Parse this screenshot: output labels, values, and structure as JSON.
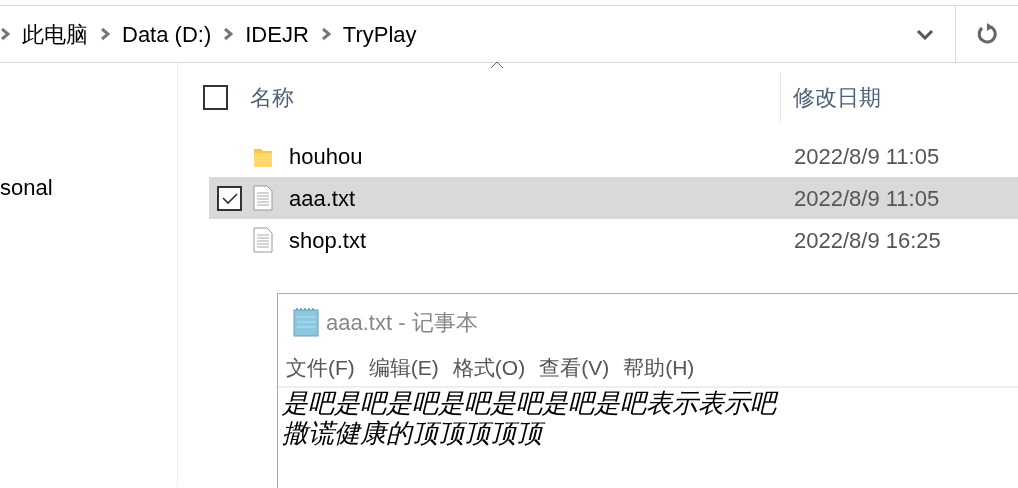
{
  "address_bar": {
    "breadcrumb": [
      "此电脑",
      "Data (D:)",
      "IDEJR",
      "TryPlay"
    ]
  },
  "sidebar": {
    "items": [
      {
        "label": "sonal"
      }
    ]
  },
  "file_list": {
    "columns": [
      "名称",
      "修改日期"
    ],
    "select_all_checked": false,
    "rows": [
      {
        "kind": "folder",
        "name": "houhou",
        "modified": "2022/8/9 11:05",
        "selected": false,
        "checked": false
      },
      {
        "kind": "text",
        "name": "aaa.txt",
        "modified": "2022/8/9 11:05",
        "selected": true,
        "checked": true
      },
      {
        "kind": "text",
        "name": "shop.txt",
        "modified": "2022/8/9 16:25",
        "selected": false,
        "checked": false
      }
    ]
  },
  "notepad": {
    "title": "aaa.txt - 记事本",
    "menu": [
      "文件(F)",
      "编辑(E)",
      "格式(O)",
      "查看(V)",
      "帮助(H)"
    ],
    "lines": [
      "是吧是吧是吧是吧是吧是吧是吧表示表示吧",
      "撒谎健康的顶顶顶顶顶"
    ]
  }
}
